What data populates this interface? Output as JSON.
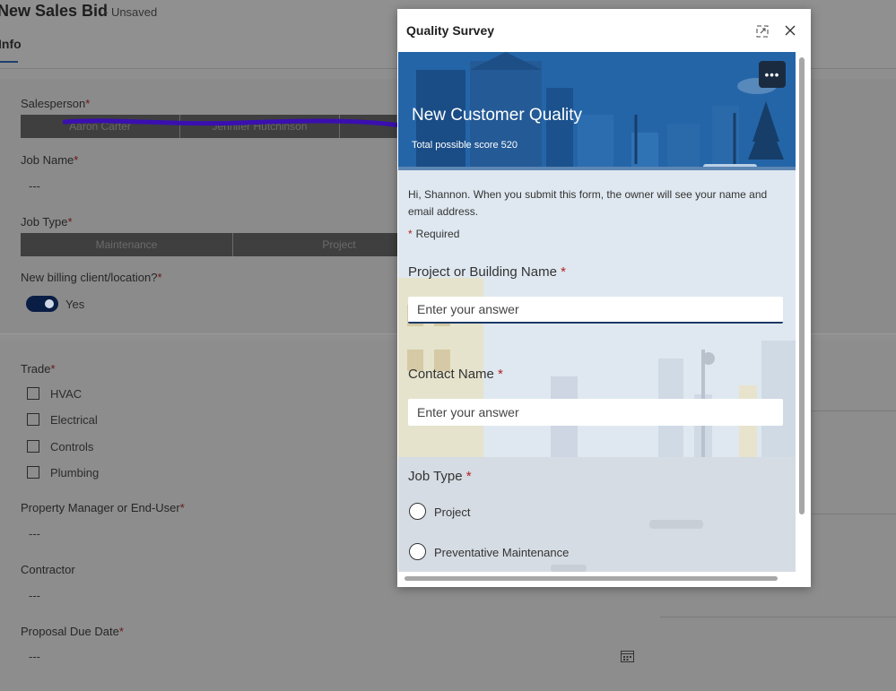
{
  "record": {
    "title": "New Sales Bid",
    "status": "- Unsaved",
    "tab": "Info"
  },
  "form": {
    "salesperson_label": "Salesperson",
    "salesperson_options": [
      "Aaron Carter",
      "Jennifer Hutchinson"
    ],
    "job_name_label": "Job Name",
    "job_name_value": "---",
    "job_type_label": "Job Type",
    "job_type_options": [
      "Maintenance",
      "Project"
    ],
    "billing_label": "New billing client/location?",
    "billing_value": "Yes",
    "trade_label": "Trade",
    "trade_options": [
      "HVAC",
      "Electrical",
      "Controls",
      "Plumbing"
    ],
    "pm_label": "Property Manager or End-User",
    "pm_value": "---",
    "contractor_label": "Contractor",
    "contractor_value": "---",
    "due_label": "Proposal Due Date",
    "due_value": "---",
    "required_mark": "*"
  },
  "modal": {
    "title": "Quality Survey",
    "banner_title": "New Customer Quality",
    "banner_sub": "Total possible score 520",
    "more_label": "•••",
    "intro": "Hi, Shannon. When you submit this form, the owner will see your name and email address.",
    "required_note": "Required",
    "questions": [
      {
        "label": "Project or Building Name",
        "placeholder": "Enter your answer"
      },
      {
        "label": "Contact Name ",
        "placeholder": "Enter your answer"
      },
      {
        "label": "Job Type",
        "options": [
          "Project",
          "Preventative Maintenance"
        ]
      }
    ]
  },
  "colors": {
    "accent": "#1b3a66",
    "banner": "#1f5fa3",
    "required": "#b12222"
  },
  "icons": [
    "expand-icon",
    "close-icon",
    "more-options-icon",
    "calendar-icon"
  ]
}
